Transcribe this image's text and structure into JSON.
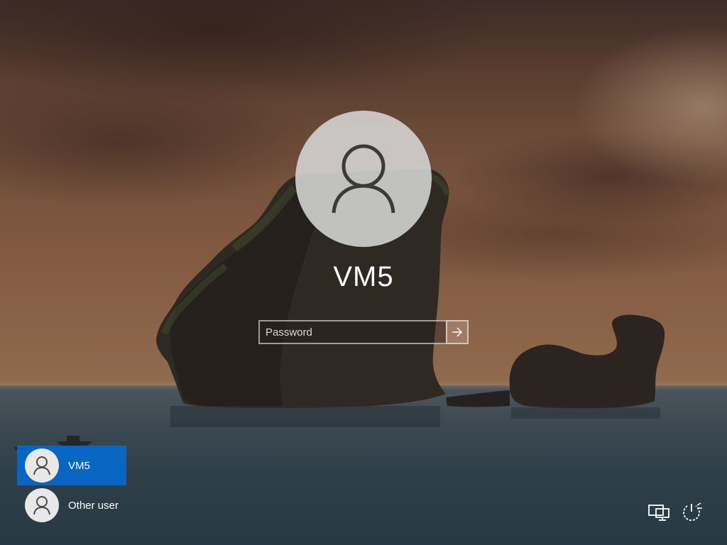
{
  "screen": {
    "type": "windows-lock-screen"
  },
  "account": {
    "name": "VM5"
  },
  "password": {
    "placeholder": "Password",
    "value": ""
  },
  "submit": {
    "icon": "arrow-right-icon"
  },
  "user_list": {
    "items": [
      {
        "label": "VM5",
        "selected": true,
        "icon": "user-icon"
      },
      {
        "label": "Other user",
        "selected": false,
        "icon": "user-icon"
      }
    ]
  },
  "system_icons": {
    "network": "network-icon",
    "power": "power-icon"
  },
  "colors": {
    "selected_user_bg": "#0a6ed8",
    "text": "#ffffff"
  }
}
